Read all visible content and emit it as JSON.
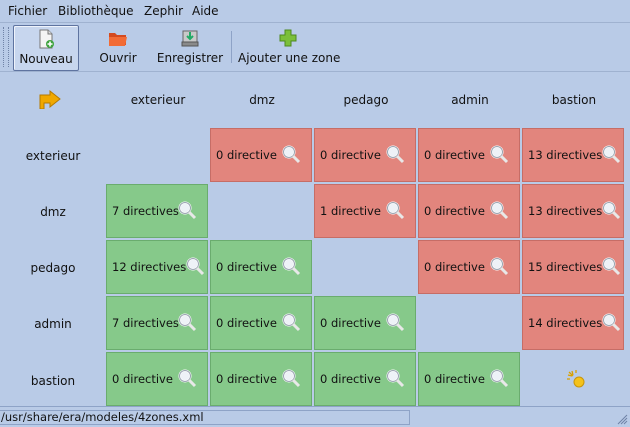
{
  "menu": [
    "Fichier",
    "Bibliothèque",
    "Zephir",
    "Aide"
  ],
  "toolbar": {
    "new_label": "Nouveau",
    "open_label": "Ouvrir",
    "save_label": "Enregistrer",
    "add_zone_label": "Ajouter une zone"
  },
  "zones": [
    "exterieur",
    "dmz",
    "pedago",
    "admin",
    "bastion"
  ],
  "matrix": {
    "exterieur": {
      "dmz": "0 directive",
      "pedago": "0 directive",
      "admin": "0 directive",
      "bastion": "13 directives"
    },
    "dmz": {
      "exterieur": "7 directives",
      "pedago": "1 directive",
      "admin": "0 directive",
      "bastion": "13 directives"
    },
    "pedago": {
      "exterieur": "12 directives",
      "dmz": "0 directive",
      "admin": "0 directive",
      "bastion": "15 directives"
    },
    "admin": {
      "exterieur": "7 directives",
      "dmz": "0 directive",
      "pedago": "0 directive",
      "bastion": "14 directives"
    },
    "bastion": {
      "exterieur": "0 directive",
      "dmz": "0 directive",
      "pedago": "0 directive",
      "admin": "0 directive"
    }
  },
  "colors": {
    "outgoing": "#e2857d",
    "incoming": "#86c98a",
    "background": "#b9cbe7"
  },
  "icons": {
    "corner": "arrow-right-icon",
    "cell": "magnifier-icon",
    "bastion_diag": "sparkle-icon"
  },
  "status": {
    "path": "/usr/share/era/modeles/4zones.xml"
  }
}
